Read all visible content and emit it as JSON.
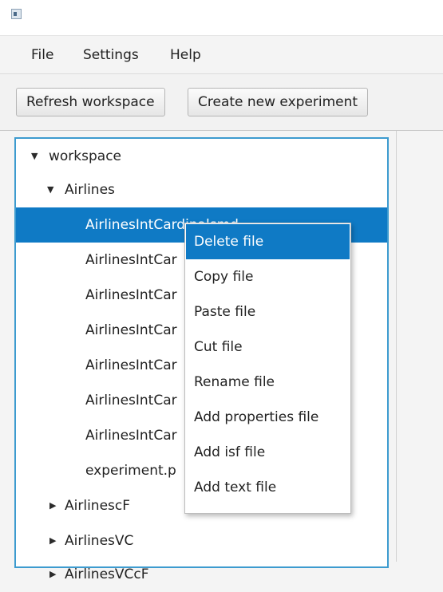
{
  "menubar": {
    "items": [
      "File",
      "Settings",
      "Help"
    ]
  },
  "toolbar": {
    "refresh_label": "Refresh workspace",
    "create_label": "Create new experiment"
  },
  "tree": {
    "root_label": "workspace",
    "airlines_label": "Airlines",
    "selected_label": "AirlinesIntCardinalsmd",
    "files": [
      "AirlinesIntCar",
      "AirlinesIntCar",
      "AirlinesIntCar",
      "AirlinesIntCar",
      "AirlinesIntCar",
      "AirlinesIntCar",
      "experiment.p"
    ],
    "folders": [
      "AirlinescF",
      "AirlinesVC",
      "AirlinesVCcF"
    ]
  },
  "context_menu": {
    "items": [
      "Delete file",
      "Copy file",
      "Paste file",
      "Cut file",
      "Rename file",
      "Add properties file",
      "Add isf file",
      "Add text file"
    ]
  },
  "colors": {
    "selection": "#0f7ac5",
    "focus_border": "#3d9bcf"
  }
}
